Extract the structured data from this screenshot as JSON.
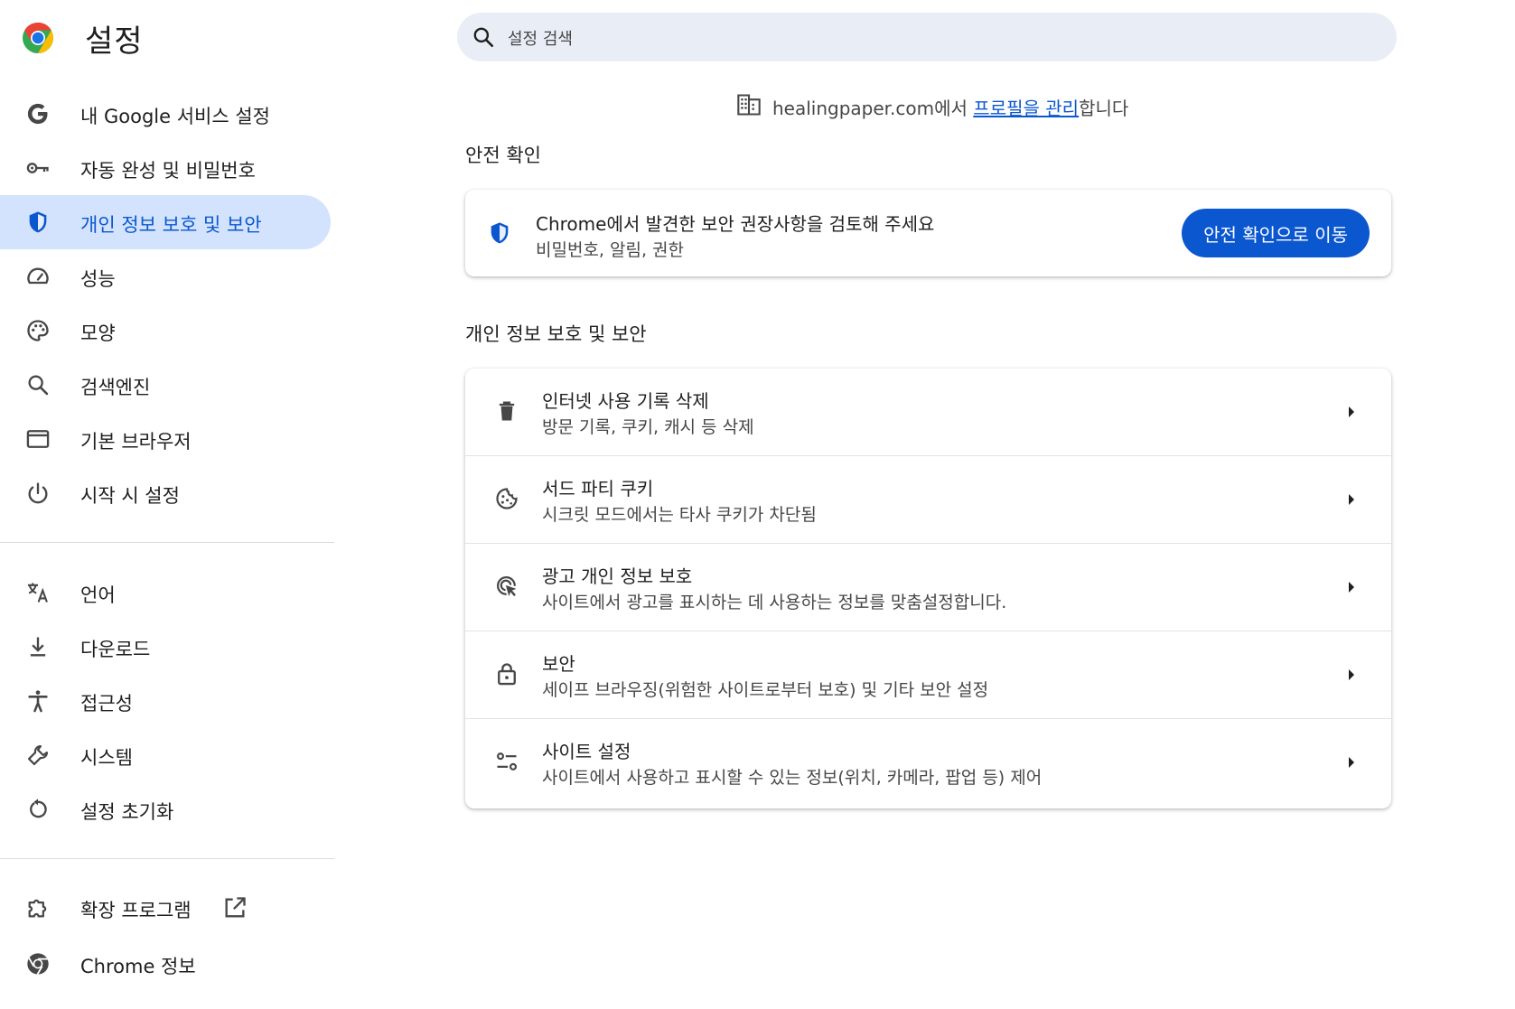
{
  "app": {
    "title": "설정"
  },
  "search": {
    "placeholder": "설정 검색"
  },
  "sidebar": {
    "items": [
      {
        "label": "내 Google 서비스 설정",
        "icon": "google-g-icon",
        "active": false
      },
      {
        "label": "자동 완성 및 비밀번호",
        "icon": "key-icon",
        "active": false
      },
      {
        "label": "개인 정보 보호 및 보안",
        "icon": "shield-icon",
        "active": true
      },
      {
        "label": "성능",
        "icon": "speedometer-icon",
        "active": false
      },
      {
        "label": "모양",
        "icon": "palette-icon",
        "active": false
      },
      {
        "label": "검색엔진",
        "icon": "search-icon",
        "active": false
      },
      {
        "label": "기본 브라우저",
        "icon": "browser-window-icon",
        "active": false
      },
      {
        "label": "시작 시 설정",
        "icon": "power-icon",
        "active": false
      }
    ],
    "items2": [
      {
        "label": "언어",
        "icon": "translate-icon"
      },
      {
        "label": "다운로드",
        "icon": "download-icon"
      },
      {
        "label": "접근성",
        "icon": "accessibility-icon"
      },
      {
        "label": "시스템",
        "icon": "wrench-icon"
      },
      {
        "label": "설정 초기화",
        "icon": "reset-icon"
      }
    ],
    "items3": [
      {
        "label": "확장 프로그램",
        "icon": "extension-icon"
      },
      {
        "label": "Chrome 정보",
        "icon": "chrome-icon"
      }
    ]
  },
  "main": {
    "managed": {
      "domain_text": "healingpaper.com에서 ",
      "link_text": "프로필을 관리",
      "suffix_text": "합니다"
    },
    "safety_check": {
      "section_title": "안전 확인",
      "title": "Chrome에서 발견한 보안 권장사항을 검토해 주세요",
      "subtitle": "비밀번호, 알림, 권한",
      "button_label": "안전 확인으로 이동"
    },
    "privacy": {
      "section_title": "개인 정보 보호 및 보안",
      "rows": [
        {
          "title": "인터넷 사용 기록 삭제",
          "subtitle": "방문 기록, 쿠키, 캐시 등 삭제",
          "icon": "trash-icon"
        },
        {
          "title": "서드 파티 쿠키",
          "subtitle": "시크릿 모드에서는 타사 쿠키가 차단됨",
          "icon": "cookie-icon"
        },
        {
          "title": "광고 개인 정보 보호",
          "subtitle": "사이트에서 광고를 표시하는 데 사용하는 정보를 맞춤설정합니다.",
          "icon": "ad-privacy-icon"
        },
        {
          "title": "보안",
          "subtitle": "세이프 브라우징(위험한 사이트로부터 보호) 및 기타 보안 설정",
          "icon": "lock-icon"
        },
        {
          "title": "사이트 설정",
          "subtitle": "사이트에서 사용하고 표시할 수 있는 정보(위치, 카메라, 팝업 등) 제어",
          "icon": "tune-icon"
        }
      ]
    }
  },
  "colors": {
    "accent": "#0b57d0",
    "active_bg": "#d3e3fd",
    "search_bg": "#e9eef6",
    "text_secondary": "#474747"
  }
}
